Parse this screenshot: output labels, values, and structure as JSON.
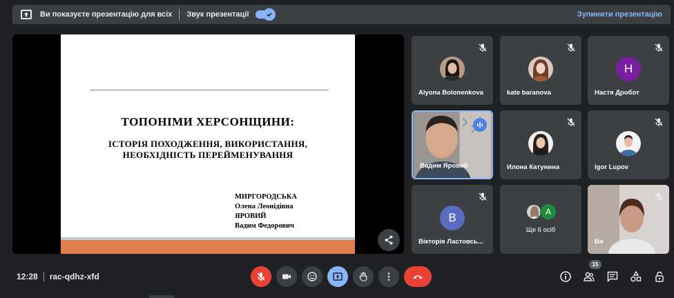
{
  "banner": {
    "message": "Ви показуєте презентацію для всіх",
    "sound_label": "Звук презентації",
    "stop_label": "Зупинити презентацію"
  },
  "slide": {
    "title": "ТОПОНІМИ ХЕРСОНЩИНИ:",
    "subtitle_line1": "ІСТОРІЯ ПОХОДЖЕННЯ, ВИКОРИСТАННЯ,",
    "subtitle_line2": "НЕОБХІДНІСТЬ ПЕРЕЙМЕНУВАННЯ",
    "author1_surname": "МИРГОРОДСЬКА",
    "author1_name": "Олена Леонідівна",
    "author2_surname": "ЯРОВИЙ",
    "author2_name": "Вадим Федорович"
  },
  "participants": [
    {
      "name": "Alyona Bolonenkova",
      "avatar": "photo",
      "muted": true
    },
    {
      "name": "kate baranova",
      "avatar": "photo",
      "muted": true
    },
    {
      "name": "Настя Дробот",
      "avatar_letter": "H",
      "avatar_color": "#7b1fa2",
      "muted": true
    },
    {
      "name": "Вадим Яровий",
      "avatar": "camera",
      "speaking": true
    },
    {
      "name": "Илона Катунина",
      "avatar": "photo",
      "muted": true
    },
    {
      "name": "Igor Lupov",
      "avatar": "photo",
      "muted": true
    },
    {
      "name": "Вікторія Ластовсь...",
      "avatar_letter": "B",
      "avatar_color": "#5c6bc0",
      "muted": true
    },
    {
      "name": "Ще 6 осіб",
      "avatar_letter": "A",
      "avatar_color": "#1e8e3e"
    },
    {
      "name": "Ви",
      "avatar": "camera",
      "muted": true
    }
  ],
  "meeting": {
    "time": "12:28",
    "code": "rac-qdhz-xfd",
    "participant_count": "15"
  },
  "colors": {
    "background": "#202124",
    "tile": "#3c4043",
    "accent": "#8ab4f8",
    "danger": "#ea4335"
  },
  "icons": [
    "present-icon",
    "check-icon",
    "share-icon",
    "mic-off-icon",
    "speaking-icon",
    "camera-icon",
    "emoji-icon",
    "present-now-icon",
    "hand-icon",
    "more-icon",
    "call-end-icon",
    "info-icon",
    "people-icon",
    "chat-icon",
    "activities-icon",
    "lock-icon"
  ]
}
